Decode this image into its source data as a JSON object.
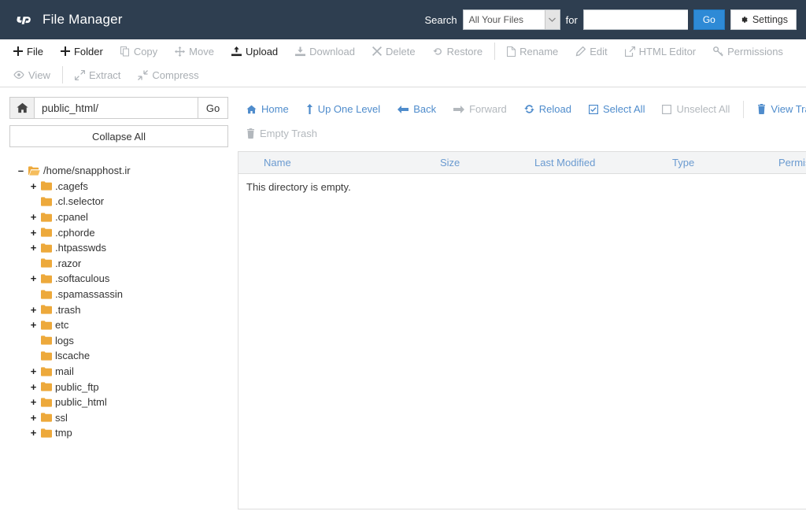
{
  "header": {
    "app_title": "File Manager",
    "logo_icon": "cpanel-logo",
    "search_label": "Search",
    "search_scope_value": "All Your Files",
    "search_scope_options": [
      "All Your Files"
    ],
    "for_label": "for",
    "search_value": "",
    "search_placeholder": "",
    "go_label": "Go",
    "settings_label": "Settings",
    "settings_icon": "gear-icon",
    "colors": {
      "bar": "#2e3e50",
      "go_button": "#2e8ad6"
    }
  },
  "toolbar": {
    "row1": [
      {
        "label": "File",
        "icon": "plus-icon",
        "enabled": true
      },
      {
        "label": "Folder",
        "icon": "plus-icon",
        "enabled": true
      },
      {
        "label": "Copy",
        "icon": "copy-icon",
        "enabled": false
      },
      {
        "label": "Move",
        "icon": "move-icon",
        "enabled": false
      },
      {
        "label": "Upload",
        "icon": "upload-icon",
        "enabled": true
      },
      {
        "label": "Download",
        "icon": "download-icon",
        "enabled": false
      },
      {
        "label": "Delete",
        "icon": "x-icon",
        "enabled": false
      },
      {
        "label": "Restore",
        "icon": "restore-icon",
        "enabled": false
      },
      {
        "label": "Rename",
        "icon": "file-icon",
        "enabled": false
      },
      {
        "label": "Edit",
        "icon": "pencil-icon",
        "enabled": false
      },
      {
        "label": "HTML Editor",
        "icon": "html-editor-icon",
        "enabled": false
      },
      {
        "label": "Permissions",
        "icon": "key-icon",
        "enabled": false
      }
    ],
    "row2": [
      {
        "label": "View",
        "icon": "eye-icon",
        "enabled": false
      },
      {
        "label": "Extract",
        "icon": "extract-icon",
        "enabled": false
      },
      {
        "label": "Compress",
        "icon": "compress-icon",
        "enabled": false
      }
    ]
  },
  "sidebar": {
    "path_home_icon": "home-icon",
    "path_value": "public_html/",
    "path_placeholder": "",
    "path_go_label": "Go",
    "collapse_all_label": "Collapse All",
    "tree": [
      {
        "label": "/home/snapphost.ir",
        "depth": 0,
        "toggle": "minus",
        "icon": "folder-open-icon"
      },
      {
        "label": ".cagefs",
        "depth": 1,
        "toggle": "plus",
        "icon": "folder-icon"
      },
      {
        "label": ".cl.selector",
        "depth": 1,
        "toggle": "none",
        "icon": "folder-icon"
      },
      {
        "label": ".cpanel",
        "depth": 1,
        "toggle": "plus",
        "icon": "folder-icon"
      },
      {
        "label": ".cphorde",
        "depth": 1,
        "toggle": "plus",
        "icon": "folder-icon"
      },
      {
        "label": ".htpasswds",
        "depth": 1,
        "toggle": "plus",
        "icon": "folder-icon"
      },
      {
        "label": ".razor",
        "depth": 1,
        "toggle": "none",
        "icon": "folder-icon"
      },
      {
        "label": ".softaculous",
        "depth": 1,
        "toggle": "plus",
        "icon": "folder-icon"
      },
      {
        "label": ".spamassassin",
        "depth": 1,
        "toggle": "none",
        "icon": "folder-icon"
      },
      {
        "label": ".trash",
        "depth": 1,
        "toggle": "plus",
        "icon": "folder-icon"
      },
      {
        "label": "etc",
        "depth": 1,
        "toggle": "plus",
        "icon": "folder-icon"
      },
      {
        "label": "logs",
        "depth": 1,
        "toggle": "none",
        "icon": "folder-icon"
      },
      {
        "label": "lscache",
        "depth": 1,
        "toggle": "none",
        "icon": "folder-icon"
      },
      {
        "label": "mail",
        "depth": 1,
        "toggle": "plus",
        "icon": "folder-icon"
      },
      {
        "label": "public_ftp",
        "depth": 1,
        "toggle": "plus",
        "icon": "folder-icon"
      },
      {
        "label": "public_html",
        "depth": 1,
        "toggle": "plus",
        "icon": "folder-icon"
      },
      {
        "label": "ssl",
        "depth": 1,
        "toggle": "plus",
        "icon": "folder-icon"
      },
      {
        "label": "tmp",
        "depth": 1,
        "toggle": "plus",
        "icon": "folder-icon"
      }
    ]
  },
  "navbar": {
    "row1": [
      {
        "label": "Home",
        "icon": "home-icon",
        "enabled": true
      },
      {
        "label": "Up One Level",
        "icon": "up-arrow-icon",
        "enabled": true
      },
      {
        "label": "Back",
        "icon": "arrow-left-icon",
        "enabled": true
      },
      {
        "label": "Forward",
        "icon": "arrow-right-icon",
        "enabled": false
      },
      {
        "label": "Reload",
        "icon": "reload-icon",
        "enabled": true
      },
      {
        "label": "Select All",
        "icon": "checkbox-checked-icon",
        "enabled": true
      },
      {
        "label": "Unselect All",
        "icon": "checkbox-empty-icon",
        "enabled": false
      },
      {
        "label": "View Trash",
        "icon": "trash-icon",
        "enabled": true
      }
    ],
    "row2": [
      {
        "label": "Empty Trash",
        "icon": "trash-icon",
        "enabled": false
      }
    ]
  },
  "filelist": {
    "columns": [
      "Name",
      "Size",
      "Last Modified",
      "Type",
      "Permissions"
    ],
    "rows": [],
    "empty_message": "This directory is empty."
  }
}
